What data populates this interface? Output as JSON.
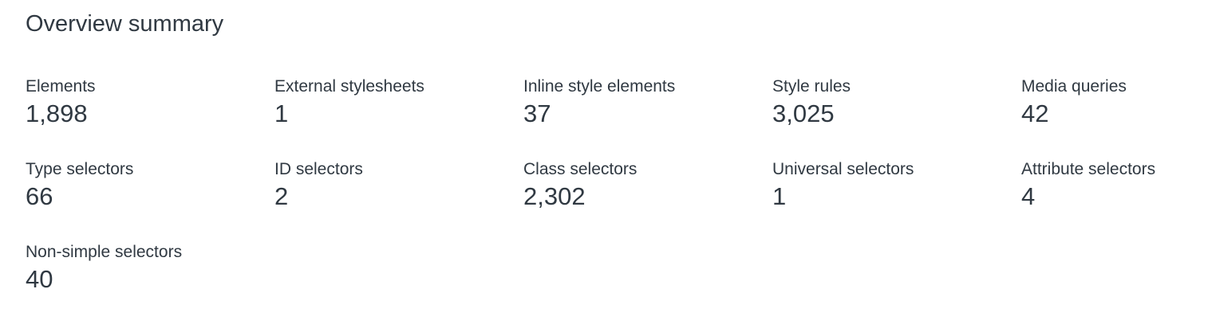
{
  "overview": {
    "title": "Overview summary",
    "stats": [
      {
        "label": "Elements",
        "value": "1,898"
      },
      {
        "label": "External stylesheets",
        "value": "1"
      },
      {
        "label": "Inline style elements",
        "value": "37"
      },
      {
        "label": "Style rules",
        "value": "3,025"
      },
      {
        "label": "Media queries",
        "value": "42"
      },
      {
        "label": "Type selectors",
        "value": "66"
      },
      {
        "label": "ID selectors",
        "value": "2"
      },
      {
        "label": "Class selectors",
        "value": "2,302"
      },
      {
        "label": "Universal selectors",
        "value": "1"
      },
      {
        "label": "Attribute selectors",
        "value": "4"
      },
      {
        "label": "Non-simple selectors",
        "value": "40"
      }
    ]
  }
}
